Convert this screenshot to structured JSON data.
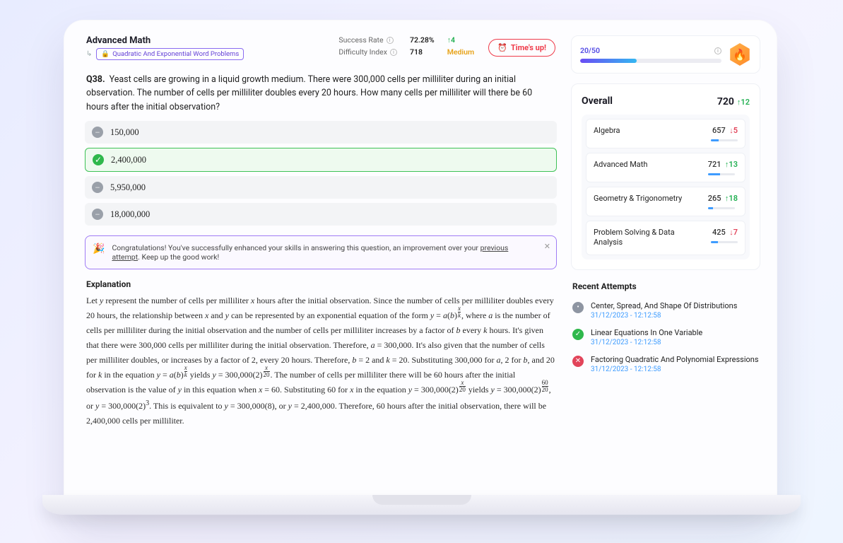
{
  "header": {
    "subject": "Advanced Math",
    "tag": "Quadratic And Exponential Word Problems",
    "stats": {
      "success_label": "Success Rate",
      "success_value": "72.28%",
      "success_delta": "↑4",
      "difficulty_label": "Difficulty Index",
      "difficulty_value": "718",
      "difficulty_tag": "Medium"
    },
    "timer": "Time's up!"
  },
  "question": {
    "number": "Q38.",
    "text": "Yeast cells are growing in a liquid growth medium. There were 300,000 cells per milliliter during an initial observation. The number of cells per milliliter doubles every 20 hours. How many cells per milliliter will there be 60 hours after the initial observation?"
  },
  "choices": [
    {
      "label": "150,000",
      "correct": false
    },
    {
      "label": "2,400,000",
      "correct": true
    },
    {
      "label": "5,950,000",
      "correct": false
    },
    {
      "label": "18,000,000",
      "correct": false
    }
  ],
  "congrats": {
    "text_a": "Congratulations! You've successfully enhanced your skills in answering this question, an improvement over your ",
    "link": "previous attempt",
    "text_b": ". Keep up the good work!"
  },
  "explanation": {
    "heading": "Explanation"
  },
  "progress": {
    "count": "20/50"
  },
  "overall": {
    "title": "Overall",
    "score": "720",
    "delta": "↑12",
    "cats": [
      {
        "name": "Algebra",
        "score": "657",
        "delta": "↓5",
        "dir": "down",
        "pct": 30
      },
      {
        "name": "Advanced Math",
        "score": "721",
        "delta": "↑13",
        "dir": "up",
        "pct": 45
      },
      {
        "name": "Geometry & Trigonometry",
        "score": "265",
        "delta": "↑18",
        "dir": "up",
        "pct": 20
      },
      {
        "name": "Problem Solving & Data Analysis",
        "score": "425",
        "delta": "↓7",
        "dir": "down",
        "pct": 25
      }
    ]
  },
  "recent": {
    "heading": "Recent Attempts",
    "items": [
      {
        "icon": "grey",
        "mark": "•",
        "title": "Center, Spread, And Shape Of Distributions",
        "date": "31/12/2023 - 12:12:58"
      },
      {
        "icon": "green",
        "mark": "✓",
        "title": "Linear Equations In One Variable",
        "date": "31/12/2023 - 12:12:58"
      },
      {
        "icon": "red",
        "mark": "✕",
        "title": "Factoring Quadratic And Polynomial Expressions",
        "date": "31/12/2023 - 12:12:58"
      }
    ]
  }
}
